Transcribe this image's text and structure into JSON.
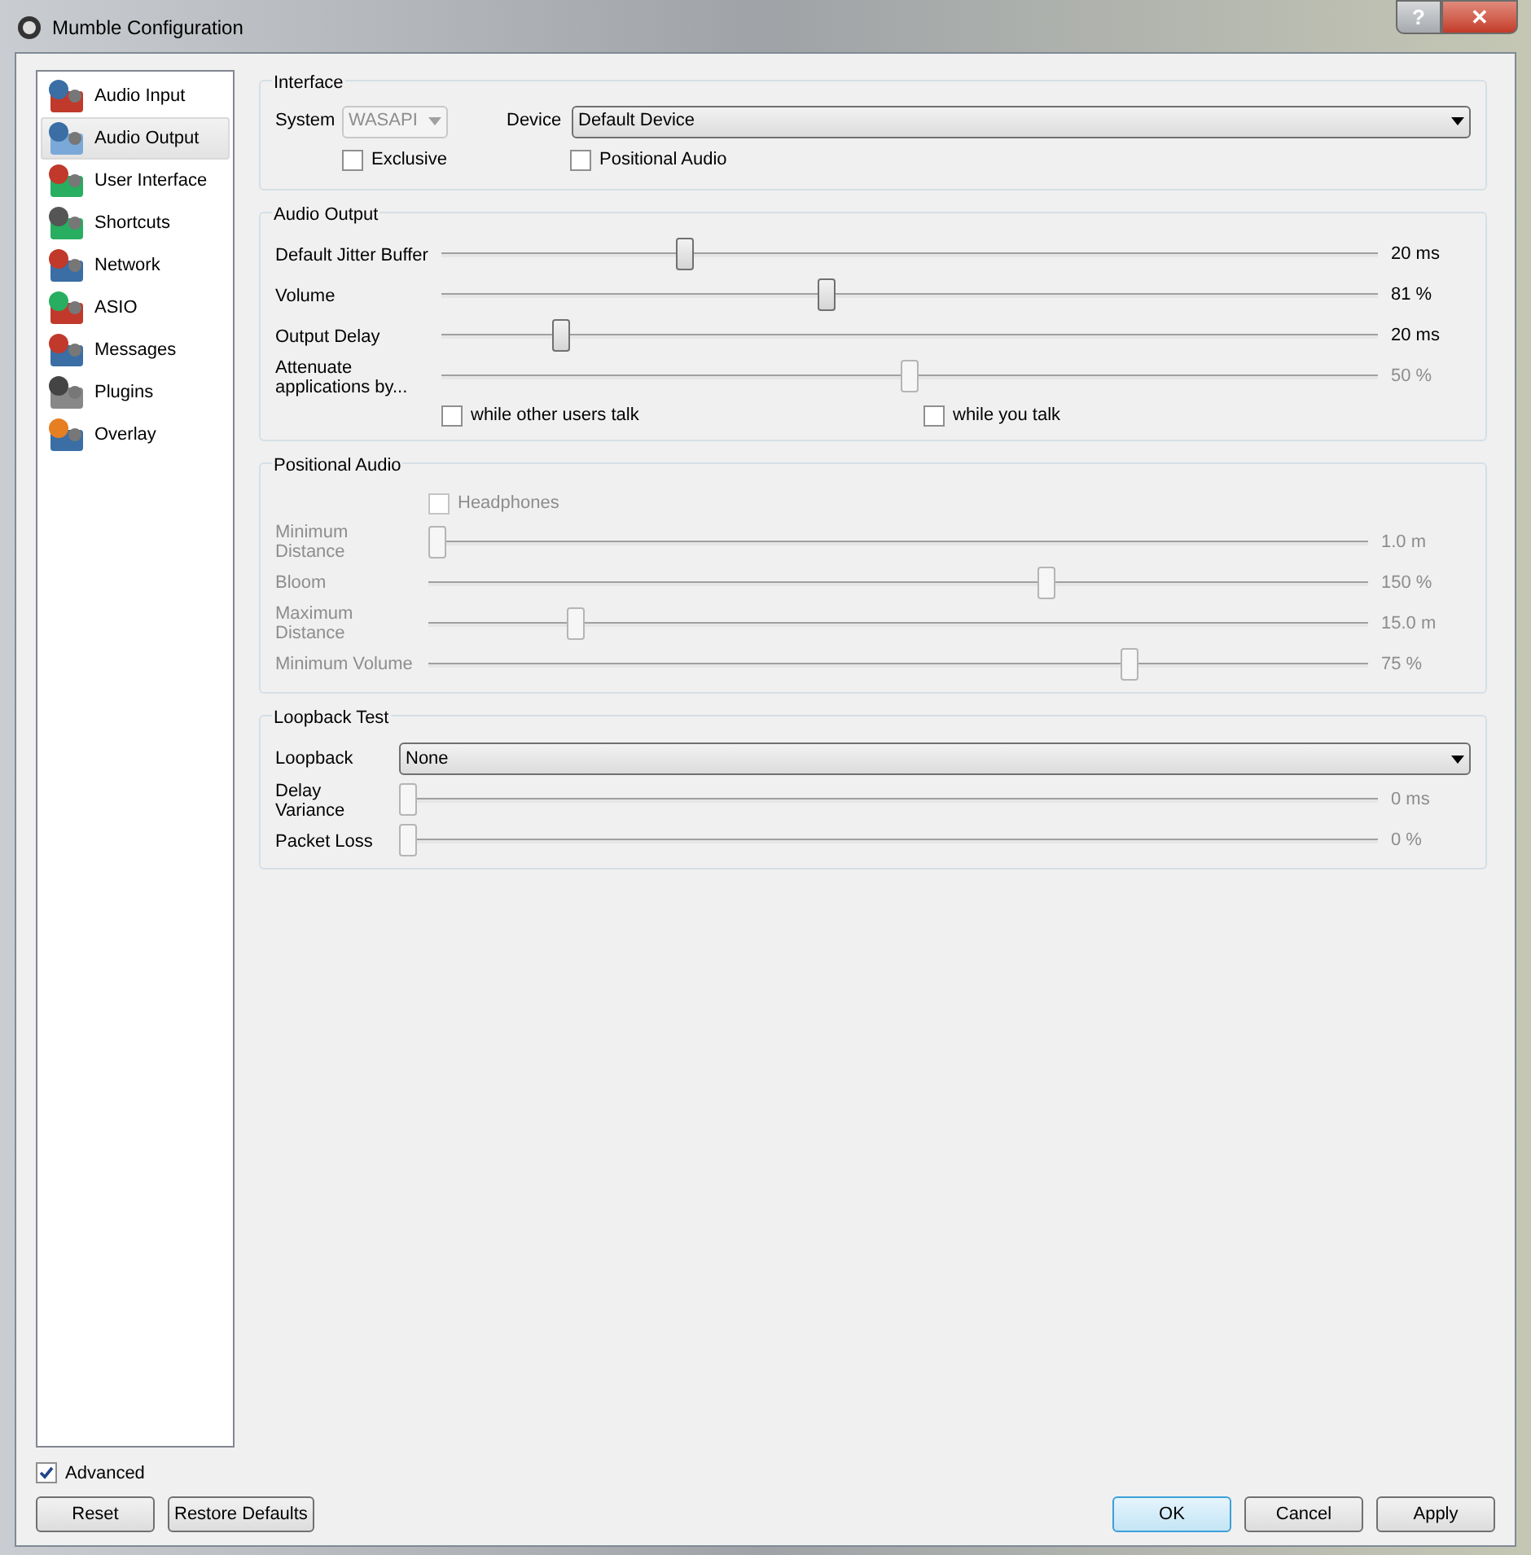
{
  "window": {
    "title": "Mumble Configuration"
  },
  "caption_buttons": [
    {
      "kind": "help",
      "glyph": "?"
    },
    {
      "kind": "close",
      "glyph": "✕"
    }
  ],
  "sidebar": {
    "items": [
      {
        "label": "Audio Input",
        "selected": false
      },
      {
        "label": "Audio Output",
        "selected": true
      },
      {
        "label": "User Interface",
        "selected": false
      },
      {
        "label": "Shortcuts",
        "selected": false
      },
      {
        "label": "Network",
        "selected": false
      },
      {
        "label": "ASIO",
        "selected": false
      },
      {
        "label": "Messages",
        "selected": false
      },
      {
        "label": "Plugins",
        "selected": false
      },
      {
        "label": "Overlay",
        "selected": false
      }
    ]
  },
  "interface": {
    "title": "Interface",
    "system_label": "System",
    "system": {
      "value": "WASAPI",
      "disabled": true
    },
    "device_label": "Device",
    "device": {
      "value": "Default Device"
    },
    "checkboxes": [
      {
        "label": "Exclusive",
        "checked": false
      },
      {
        "label": "Positional Audio",
        "checked": false
      }
    ]
  },
  "audio_output": {
    "title": "Audio Output",
    "sliders": [
      {
        "label": "Default Jitter Buffer",
        "level": 0.255,
        "reading": "20 ms",
        "disabled": false
      },
      {
        "label": "Volume",
        "level": 0.41,
        "reading": "81 %",
        "disabled": false
      },
      {
        "label": "Output Delay",
        "level": 0.12,
        "reading": "20 ms",
        "disabled": false
      },
      {
        "label": "Attenuate applications by...",
        "level": 0.5,
        "reading": "50 %",
        "disabled": true
      }
    ],
    "checkboxes": [
      {
        "label": "while other users talk",
        "checked": false
      },
      {
        "label": "while you talk",
        "checked": false
      }
    ]
  },
  "positional_audio": {
    "title": "Positional Audio",
    "disabled": true,
    "headphones": {
      "label": "Headphones",
      "checked": false
    },
    "sliders": [
      {
        "label": "Minimum Distance",
        "level": 0,
        "reading": "1.0 m",
        "disabled": true
      },
      {
        "label": "Bloom",
        "level": 0.66,
        "reading": "150 %",
        "disabled": true
      },
      {
        "label": "Maximum Distance",
        "level": 0.15,
        "reading": "15.0 m",
        "disabled": true
      },
      {
        "label": "Minimum Volume",
        "level": 0.75,
        "reading": "75 %",
        "disabled": true
      }
    ]
  },
  "loopback_test": {
    "title": "Loopback Test",
    "loopback_label": "Loopback",
    "loopback": {
      "value": "None"
    },
    "sliders": [
      {
        "label": "Delay Variance",
        "level": 0,
        "reading": "0 ms",
        "disabled": true
      },
      {
        "label": "Packet Loss",
        "level": 0,
        "reading": "0 %",
        "disabled": true
      }
    ]
  },
  "advanced": {
    "label": "Advanced",
    "checked": true
  },
  "left_buttons": [
    {
      "label": "Reset",
      "focused": false
    },
    {
      "label": "Restore Defaults",
      "focused": false
    }
  ],
  "right_buttons": [
    {
      "label": "OK",
      "focused": true
    },
    {
      "label": "Cancel",
      "focused": false
    },
    {
      "label": "Apply",
      "focused": false
    }
  ]
}
